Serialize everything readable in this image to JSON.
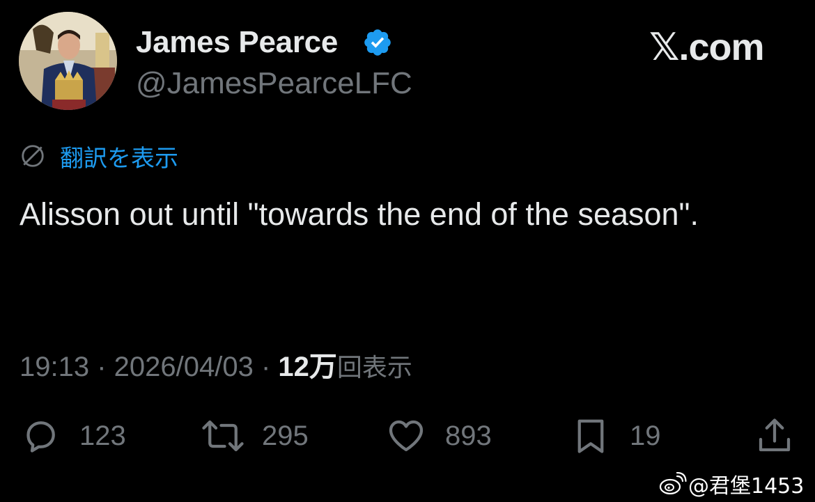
{
  "author": {
    "display_name": "James Pearce",
    "handle": "@JamesPearceLFC",
    "verified": true
  },
  "brand": {
    "label": "𝕏.com"
  },
  "translate": {
    "label": "翻訳を表示",
    "icon": "globe-icon"
  },
  "tweet": {
    "text": "Alisson out until \"towards the end of the season\"."
  },
  "meta": {
    "time": "19:13",
    "date": "2026/04/03",
    "separator": " · ",
    "views_count": "12万",
    "views_label": "回表示"
  },
  "actions": {
    "reply": {
      "icon": "reply-icon",
      "count": "123"
    },
    "retweet": {
      "icon": "retweet-icon",
      "count": "295"
    },
    "like": {
      "icon": "heart-icon",
      "count": "893"
    },
    "bookmark": {
      "icon": "bookmark-icon",
      "count": "19"
    },
    "share": {
      "icon": "share-icon"
    }
  },
  "watermark": {
    "text": "@君堡1453",
    "icon": "weibo-icon"
  },
  "colors": {
    "background": "#000000",
    "text_primary": "#e7e9ea",
    "text_secondary": "#71767b",
    "accent": "#1d9bf0"
  }
}
